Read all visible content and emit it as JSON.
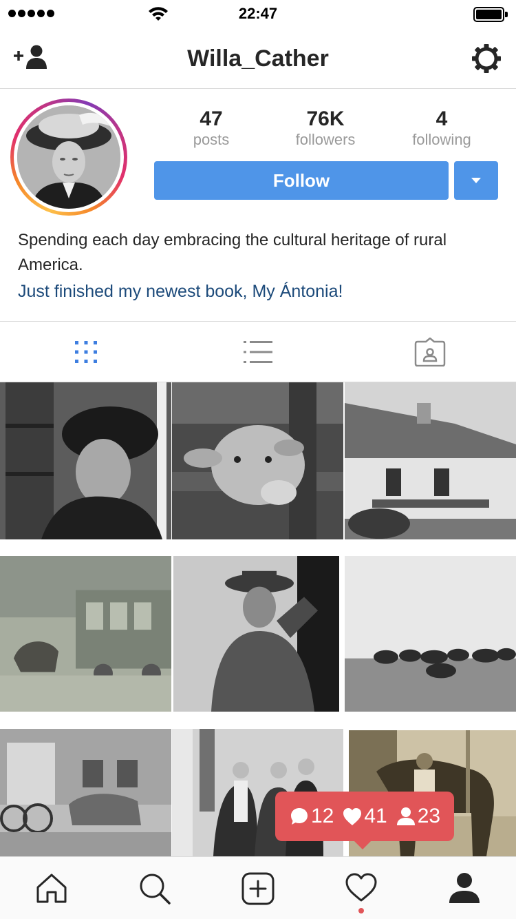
{
  "status_bar": {
    "time": "22:47",
    "signal_bars": 5,
    "battery_level": 1.0
  },
  "header": {
    "username": "Willa_Cather",
    "left_icon": "add-person-icon",
    "right_icon": "gear-icon"
  },
  "profile": {
    "stats": [
      {
        "value": "47",
        "label": "posts"
      },
      {
        "value": "76K",
        "label": "followers"
      },
      {
        "value": "4",
        "label": "following"
      }
    ],
    "follow_label": "Follow",
    "bio_text": "Spending each day embracing the cultural heritage of rural America.",
    "bio_link": "Just finished my newest book, My Ántonia!"
  },
  "tabs": [
    {
      "icon": "grid-icon",
      "active": true
    },
    {
      "icon": "list-icon",
      "active": false
    },
    {
      "icon": "tagged-icon",
      "active": false
    }
  ],
  "notification": {
    "comments": "12",
    "likes": "41",
    "follows": "23"
  },
  "bottom_nav": [
    {
      "icon": "home-icon"
    },
    {
      "icon": "search-icon"
    },
    {
      "icon": "add-post-icon"
    },
    {
      "icon": "heart-icon",
      "has_badge": true
    },
    {
      "icon": "profile-icon",
      "active": true
    }
  ],
  "colors": {
    "accent": "#4f95e8",
    "notification": "#e15558",
    "link": "#1c4a7a",
    "active_tab": "#3d7ee0"
  }
}
